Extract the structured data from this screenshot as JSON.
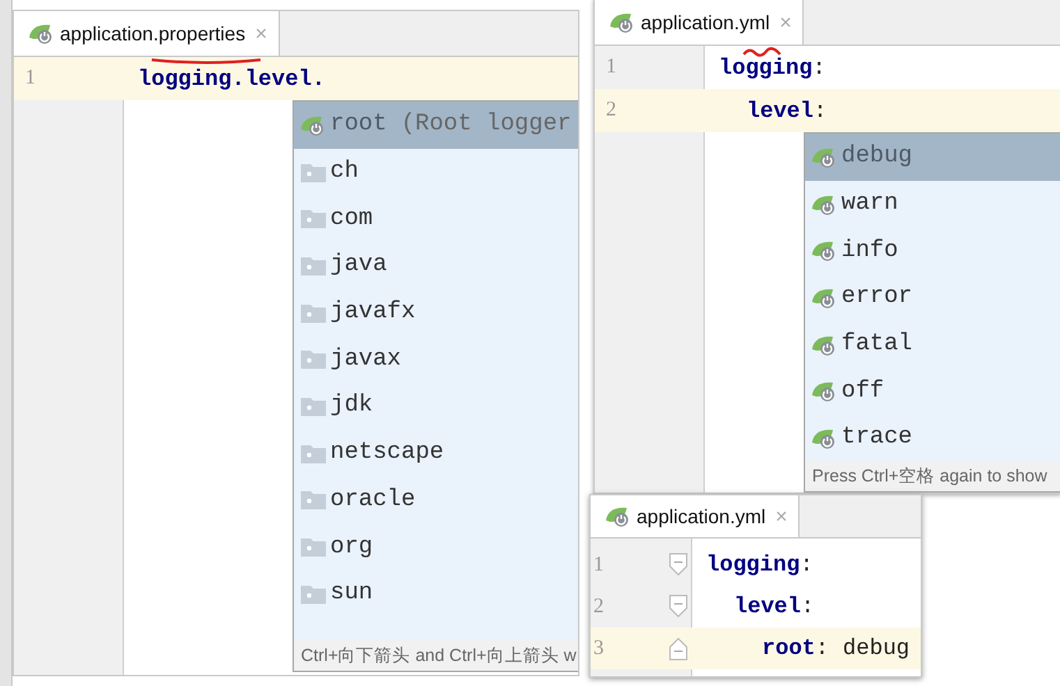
{
  "panels": [
    {
      "tab": {
        "label": "application.properties",
        "close": "×",
        "selected": true
      },
      "lines": [
        {
          "number": "1",
          "current": true,
          "tokens": [
            {
              "text": "logging.level.",
              "kind": "key"
            }
          ]
        }
      ],
      "completion": {
        "items": [
          {
            "label": "root",
            "detail": "(Root logger",
            "kind": "logger",
            "selected": true
          },
          {
            "label": "ch",
            "kind": "package",
            "selected": false
          },
          {
            "label": "com",
            "kind": "package",
            "selected": false
          },
          {
            "label": "java",
            "kind": "package",
            "selected": false
          },
          {
            "label": "javafx",
            "kind": "package",
            "selected": false
          },
          {
            "label": "javax",
            "kind": "package",
            "selected": false
          },
          {
            "label": "jdk",
            "kind": "package",
            "selected": false
          },
          {
            "label": "netscape",
            "kind": "package",
            "selected": false
          },
          {
            "label": "oracle",
            "kind": "package",
            "selected": false
          },
          {
            "label": "org",
            "kind": "package",
            "selected": false
          },
          {
            "label": "sun",
            "kind": "package",
            "selected": false
          }
        ],
        "footer": "Ctrl+向下箭头 and Ctrl+向上箭头 w"
      }
    },
    {
      "tab": {
        "label": "application.yml",
        "close": "×",
        "selected": true
      },
      "lines": [
        {
          "number": "1",
          "current": false,
          "tokens": [
            {
              "text": "logging",
              "kind": "key"
            },
            {
              "text": ":",
              "kind": "punct"
            }
          ],
          "children": [
            {
              "number": "2",
              "current": true,
              "tokens": [
                {
                  "text": "level",
                  "kind": "key"
                },
                {
                  "text": ":",
                  "kind": "punct"
                }
              ]
            }
          ]
        }
      ],
      "completion": {
        "items": [
          {
            "label": "debug",
            "kind": "logger",
            "selected": true
          },
          {
            "label": "warn",
            "kind": "logger",
            "selected": false
          },
          {
            "label": "info",
            "kind": "logger",
            "selected": false
          },
          {
            "label": "error",
            "kind": "logger",
            "selected": false
          },
          {
            "label": "fatal",
            "kind": "logger",
            "selected": false
          },
          {
            "label": "off",
            "kind": "logger",
            "selected": false
          },
          {
            "label": "trace",
            "kind": "logger",
            "selected": false
          }
        ],
        "footer": "Press Ctrl+空格 again to show"
      }
    },
    {
      "tab": {
        "label": "application.yml",
        "close": "×",
        "selected": true
      },
      "lines": [
        {
          "number": "1",
          "current": false,
          "fold_start": true,
          "tokens": [
            {
              "text": "logging",
              "kind": "key"
            },
            {
              "text": ":",
              "kind": "punct"
            }
          ],
          "children": [
            {
              "number": "2",
              "current": false,
              "fold_start": true,
              "tokens": [
                {
                  "text": "level",
                  "kind": "key"
                },
                {
                  "text": ":",
                  "kind": "punct"
                }
              ],
              "children": [
                {
                  "number": "3",
                  "current": true,
                  "fold_start": false,
                  "tokens": [
                    {
                      "text": "root",
                      "kind": "key"
                    },
                    {
                      "text": ":",
                      "kind": "punct"
                    },
                    {
                      "text": "debug",
                      "kind": "value"
                    }
                  ]
                }
              ]
            }
          ]
        }
      ]
    }
  ]
}
